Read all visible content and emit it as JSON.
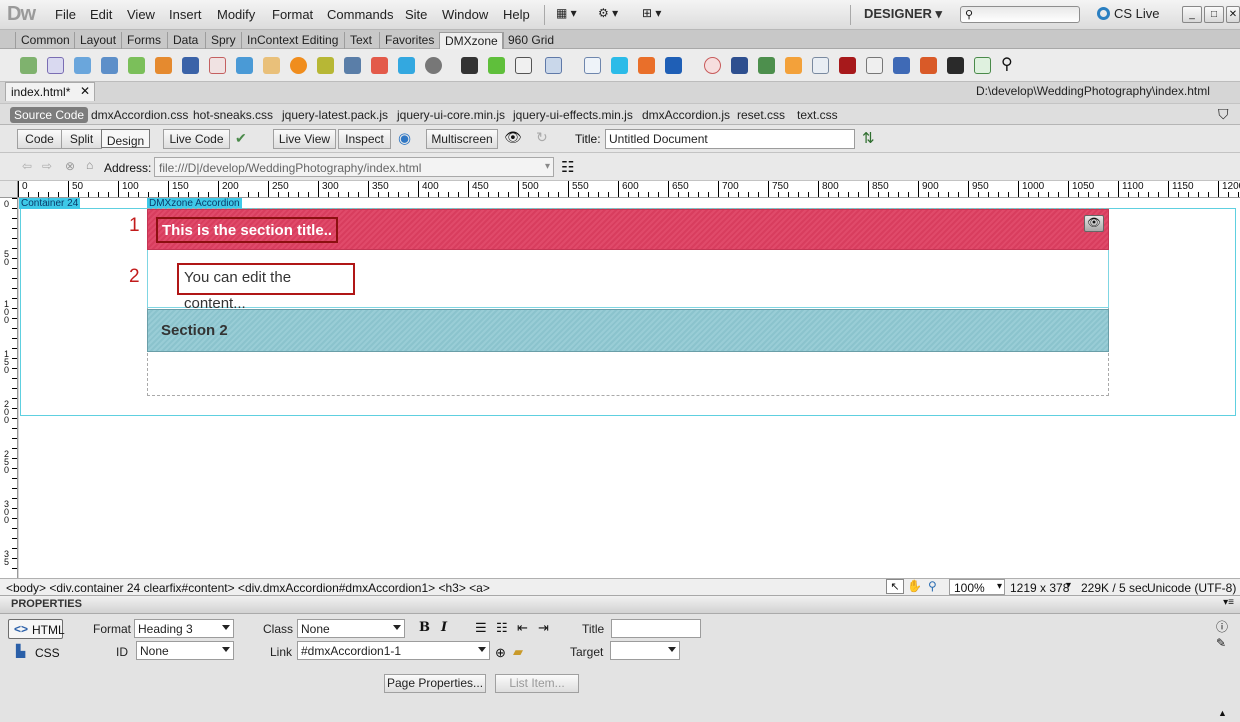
{
  "app": {
    "logo": "Dw"
  },
  "menu": [
    "File",
    "Edit",
    "View",
    "Insert",
    "Modify",
    "Format",
    "Commands",
    "Site",
    "Window",
    "Help"
  ],
  "workspace": "DESIGNER",
  "cslive": "CS Live",
  "insert_tabs": [
    "Common",
    "Layout",
    "Forms",
    "Data",
    "Spry",
    "InContext Editing",
    "Text",
    "Favorites",
    "DMXzone",
    "960 Grid"
  ],
  "active_insert_tab": "DMXzone",
  "document": {
    "tab": "index.html*",
    "path": "D:\\develop\\WeddingPhotography\\index.html"
  },
  "related_files": [
    "Source Code",
    "dmxAccordion.css",
    "hot-sneaks.css",
    "jquery-latest.pack.js",
    "jquery-ui-core.min.js",
    "jquery-ui-effects.min.js",
    "dmxAccordion.js",
    "reset.css",
    "text.css"
  ],
  "doc_toolbar": {
    "code": "Code",
    "split": "Split",
    "design": "Design",
    "live_code": "Live Code",
    "live_view": "Live View",
    "inspect": "Inspect",
    "multiscreen": "Multiscreen",
    "title_label": "Title:",
    "title_value": "Untitled Document"
  },
  "nav": {
    "address_label": "Address:",
    "address_value": "file:///D|/develop/WeddingPhotography/index.html"
  },
  "ruler": {
    "h": [
      "0",
      "50",
      "100",
      "150",
      "200",
      "250",
      "300",
      "350",
      "400",
      "450",
      "500",
      "550",
      "600",
      "650",
      "700",
      "750",
      "800",
      "850",
      "900",
      "950",
      "1000",
      "1050",
      "1100",
      "1150",
      "1200"
    ],
    "v": [
      "0",
      "5\n0",
      "1\n0\n0",
      "1\n5\n0",
      "2\n0\n0",
      "2\n5\n0",
      "3\n0\n0",
      "3\n5"
    ]
  },
  "canvas": {
    "container_label": "Container 24",
    "accordion_label": "DMXzone Accordion",
    "section1_title": "This is the section title..",
    "section1_content": "You can edit the content...",
    "section2_title": "Section 2",
    "marker1": "1",
    "marker2": "2"
  },
  "status": {
    "tag_path": "<body> <div.container  24 clearfix#content> <div.dmxAccordion#dmxAccordion1> <h3> <a>",
    "zoom": "100%",
    "size": "1219 x 378",
    "download": "229K / 5 sec",
    "encoding": "Unicode (UTF-8)"
  },
  "properties": {
    "header": "PROPERTIES",
    "html": "HTML",
    "css": "CSS",
    "format_label": "Format",
    "format_value": "Heading 3",
    "id_label": "ID",
    "id_value": "None",
    "class_label": "Class",
    "class_value": "None",
    "link_label": "Link",
    "link_value": "#dmxAccordion1-1",
    "bold": "B",
    "italic": "I",
    "title_label": "Title",
    "target_label": "Target",
    "page_properties": "Page Properties...",
    "list_item": "List Item..."
  }
}
